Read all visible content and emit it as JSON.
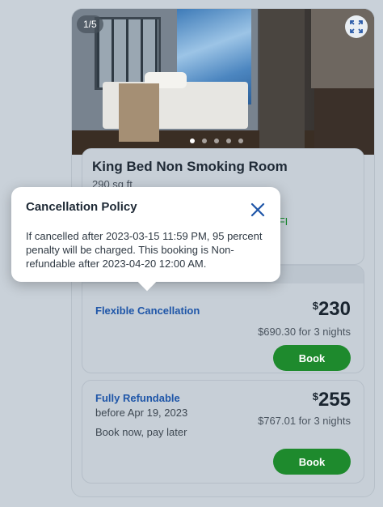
{
  "gallery": {
    "counter": "1/5",
    "dots_count": 5,
    "active_dot": 0
  },
  "room": {
    "title": "King Bed Non Smoking Room",
    "size": "290 sq ft",
    "amenity_partial": "e WIFI"
  },
  "popover": {
    "title": "Cancellation Policy",
    "text": "If cancelled after 2023-03-15 11:59 PM, 95 percent penalty will be charged. This booking is Non-refundable after 2023-04-20 12:00 AM."
  },
  "rates": [
    {
      "name": "Flexible Cancellation",
      "currency": "$",
      "price": "230",
      "total": "$690.30 for 3 nights",
      "book_label": "Book"
    },
    {
      "name": "Fully Refundable",
      "deadline": "before Apr 19, 2023",
      "note": "Book now, pay later",
      "currency": "$",
      "price": "255",
      "total": "$767.01 for 3 nights",
      "book_label": "Book"
    }
  ],
  "colors": {
    "brand_link": "#1f56a8",
    "book_green": "#1e8a2d",
    "wifi_green": "#168a2e"
  }
}
